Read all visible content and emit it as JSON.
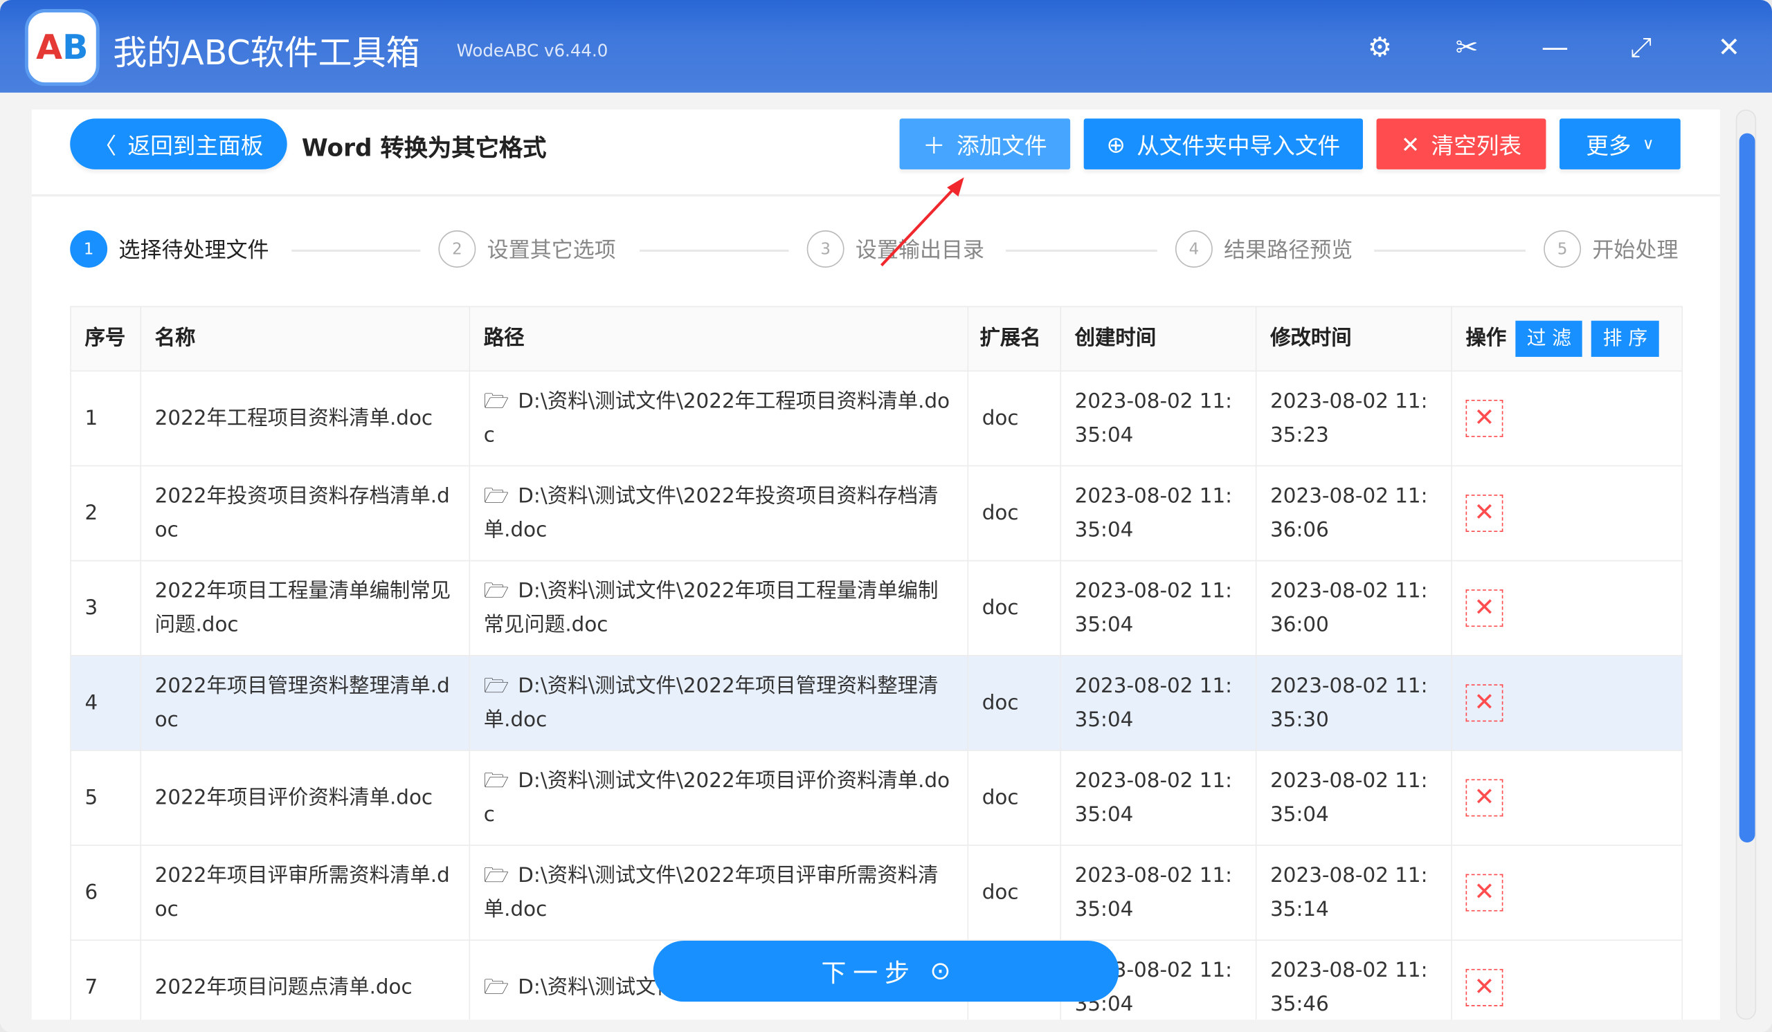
{
  "app": {
    "title": "我的ABC软件工具箱",
    "version": "WodeABC v6.44.0",
    "logo": "AB"
  },
  "window_icons": [
    "gear-icon",
    "scissors-icon",
    "minimize-icon",
    "maximize-icon",
    "close-icon"
  ],
  "toolbar": {
    "back": "返回到主面板",
    "page_title": "Word 转换为其它格式",
    "add": "添加文件",
    "import": "从文件夹中导入文件",
    "clear": "清空列表",
    "more": "更多"
  },
  "steps": [
    {
      "n": "1",
      "label": "选择待处理文件"
    },
    {
      "n": "2",
      "label": "设置其它选项"
    },
    {
      "n": "3",
      "label": "设置输出目录"
    },
    {
      "n": "4",
      "label": "结果路径预览"
    },
    {
      "n": "5",
      "label": "开始处理"
    }
  ],
  "table": {
    "headers": {
      "no": "序号",
      "name": "名称",
      "path": "路径",
      "ext": "扩展名",
      "created": "创建时间",
      "modified": "修改时间",
      "ops": "操作",
      "filter": "过 滤",
      "sort": "排 序"
    },
    "rows": [
      {
        "no": "1",
        "name": "2022年工程项目资料清单.doc",
        "path": "D:\\资料\\测试文件\\2022年工程项目资料清单.doc",
        "ext": "doc",
        "created": "2023-08-02 11:35:04",
        "modified": "2023-08-02 11:35:23"
      },
      {
        "no": "2",
        "name": "2022年投资项目资料存档清单.doc",
        "path": "D:\\资料\\测试文件\\2022年投资项目资料存档清单.doc",
        "ext": "doc",
        "created": "2023-08-02 11:35:04",
        "modified": "2023-08-02 11:36:06"
      },
      {
        "no": "3",
        "name": "2022年项目工程量清单编制常见问题.doc",
        "path": "D:\\资料\\测试文件\\2022年项目工程量清单编制常见问题.doc",
        "ext": "doc",
        "created": "2023-08-02 11:35:04",
        "modified": "2023-08-02 11:36:00"
      },
      {
        "no": "4",
        "name": "2022年项目管理资料整理清单.doc",
        "path": "D:\\资料\\测试文件\\2022年项目管理资料整理清单.doc",
        "ext": "doc",
        "created": "2023-08-02 11:35:04",
        "modified": "2023-08-02 11:35:30"
      },
      {
        "no": "5",
        "name": "2022年项目评价资料清单.doc",
        "path": "D:\\资料\\测试文件\\2022年项目评价资料清单.doc",
        "ext": "doc",
        "created": "2023-08-02 11:35:04",
        "modified": "2023-08-02 11:35:04"
      },
      {
        "no": "6",
        "name": "2022年项目评审所需资料清单.doc",
        "path": "D:\\资料\\测试文件\\2022年项目评审所需资料清单.doc",
        "ext": "doc",
        "created": "2023-08-02 11:35:04",
        "modified": "2023-08-02 11:35:14"
      },
      {
        "no": "7",
        "name": "2022年项目问题点清单.doc",
        "path": "D:\\资料\\测试文件\\2022年项目问题点清单.doc",
        "ext": "doc",
        "created": "2023-08-02 11:35:04",
        "modified": "2023-08-02 11:35:46"
      }
    ]
  },
  "next": "下一步",
  "colors": {
    "primary": "#1890ff",
    "danger": "#ff4d4f",
    "titlebar": "#2a6ad8",
    "selected_row": "#e8f0fc"
  }
}
